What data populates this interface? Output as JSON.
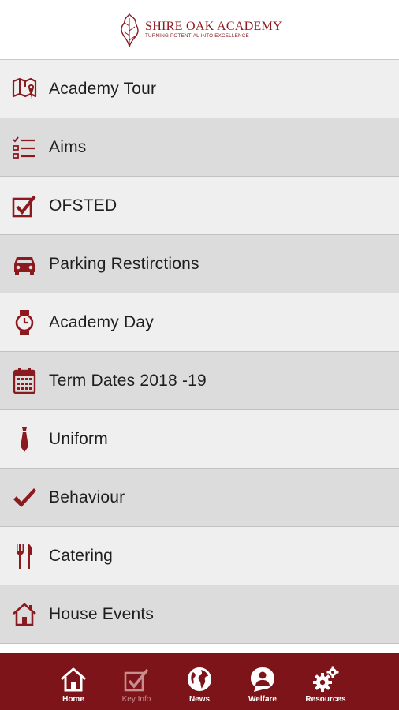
{
  "header": {
    "logo_title": "SHIRE OAK ACADEMY",
    "logo_tagline": "TURNING POTENTIAL INTO EXCELLENCE"
  },
  "colors": {
    "accent": "#8b1a1f",
    "tabbar": "#7d1419"
  },
  "menu": {
    "items": [
      {
        "label": "Academy Tour",
        "icon": "map-pin-icon"
      },
      {
        "label": "Aims",
        "icon": "checklist-icon"
      },
      {
        "label": "OFSTED",
        "icon": "checkbox-icon"
      },
      {
        "label": "Parking Restirctions",
        "icon": "car-icon"
      },
      {
        "label": "Academy Day",
        "icon": "watch-icon"
      },
      {
        "label": "Term Dates 2018 -19",
        "icon": "calendar-icon"
      },
      {
        "label": "Uniform",
        "icon": "tie-icon"
      },
      {
        "label": "Behaviour",
        "icon": "checkmark-icon"
      },
      {
        "label": "Catering",
        "icon": "cutlery-icon"
      },
      {
        "label": "House Events",
        "icon": "house-icon"
      }
    ]
  },
  "tabbar": {
    "tabs": [
      {
        "label": "Home",
        "icon": "home-icon",
        "active": true
      },
      {
        "label": "Key Info",
        "icon": "key-info-icon",
        "active": false
      },
      {
        "label": "News",
        "icon": "globe-icon",
        "active": true
      },
      {
        "label": "Welfare",
        "icon": "person-bubble-icon",
        "active": true
      },
      {
        "label": "Resources",
        "icon": "gears-icon",
        "active": true
      }
    ]
  }
}
